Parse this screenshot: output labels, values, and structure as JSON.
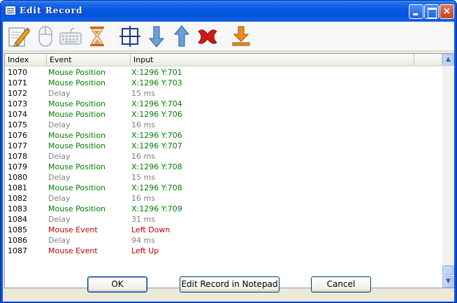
{
  "window": {
    "title": "Edit Record"
  },
  "titlebar_buttons": {
    "close_glyph": "×"
  },
  "toolbar": {
    "tools": [
      "edit-icon",
      "mouse-icon",
      "keyboard-icon",
      "hourglass-icon",
      "select-region-icon",
      "move-down-icon",
      "move-up-icon",
      "delete-icon",
      "import-icon"
    ]
  },
  "columns": [
    "Index",
    "Event",
    "Input"
  ],
  "colors": {
    "mouse_position": "#008000",
    "delay": "#808080",
    "mouse_event": "#c00000"
  },
  "rows": [
    {
      "index": "1070",
      "event": "Mouse Position",
      "input": "X:1296 Y:701",
      "kind": "mouse_position"
    },
    {
      "index": "1071",
      "event": "Mouse Position",
      "input": "X:1296 Y:703",
      "kind": "mouse_position"
    },
    {
      "index": "1072",
      "event": "Delay",
      "input": "15 ms",
      "kind": "delay"
    },
    {
      "index": "1073",
      "event": "Mouse Position",
      "input": "X:1296 Y:704",
      "kind": "mouse_position"
    },
    {
      "index": "1074",
      "event": "Mouse Position",
      "input": "X:1296 Y:706",
      "kind": "mouse_position"
    },
    {
      "index": "1075",
      "event": "Delay",
      "input": "16 ms",
      "kind": "delay"
    },
    {
      "index": "1076",
      "event": "Mouse Position",
      "input": "X:1296 Y:706",
      "kind": "mouse_position"
    },
    {
      "index": "1077",
      "event": "Mouse Position",
      "input": "X:1296 Y:707",
      "kind": "mouse_position"
    },
    {
      "index": "1078",
      "event": "Delay",
      "input": "16 ms",
      "kind": "delay"
    },
    {
      "index": "1079",
      "event": "Mouse Position",
      "input": "X:1296 Y:708",
      "kind": "mouse_position"
    },
    {
      "index": "1080",
      "event": "Delay",
      "input": "15 ms",
      "kind": "delay"
    },
    {
      "index": "1081",
      "event": "Mouse Position",
      "input": "X:1296 Y:708",
      "kind": "mouse_position"
    },
    {
      "index": "1082",
      "event": "Delay",
      "input": "16 ms",
      "kind": "delay"
    },
    {
      "index": "1083",
      "event": "Mouse Position",
      "input": "X:1296 Y:709",
      "kind": "mouse_position"
    },
    {
      "index": "1084",
      "event": "Delay",
      "input": "31 ms",
      "kind": "delay"
    },
    {
      "index": "1085",
      "event": "Mouse Event",
      "input": "Left Down",
      "kind": "mouse_event"
    },
    {
      "index": "1086",
      "event": "Delay",
      "input": "94 ms",
      "kind": "delay"
    },
    {
      "index": "1087",
      "event": "Mouse Event",
      "input": "Left Up",
      "kind": "mouse_event"
    }
  ],
  "buttons": {
    "ok": "OK",
    "notepad": "Edit Record in Notepad",
    "cancel": "Cancel"
  }
}
